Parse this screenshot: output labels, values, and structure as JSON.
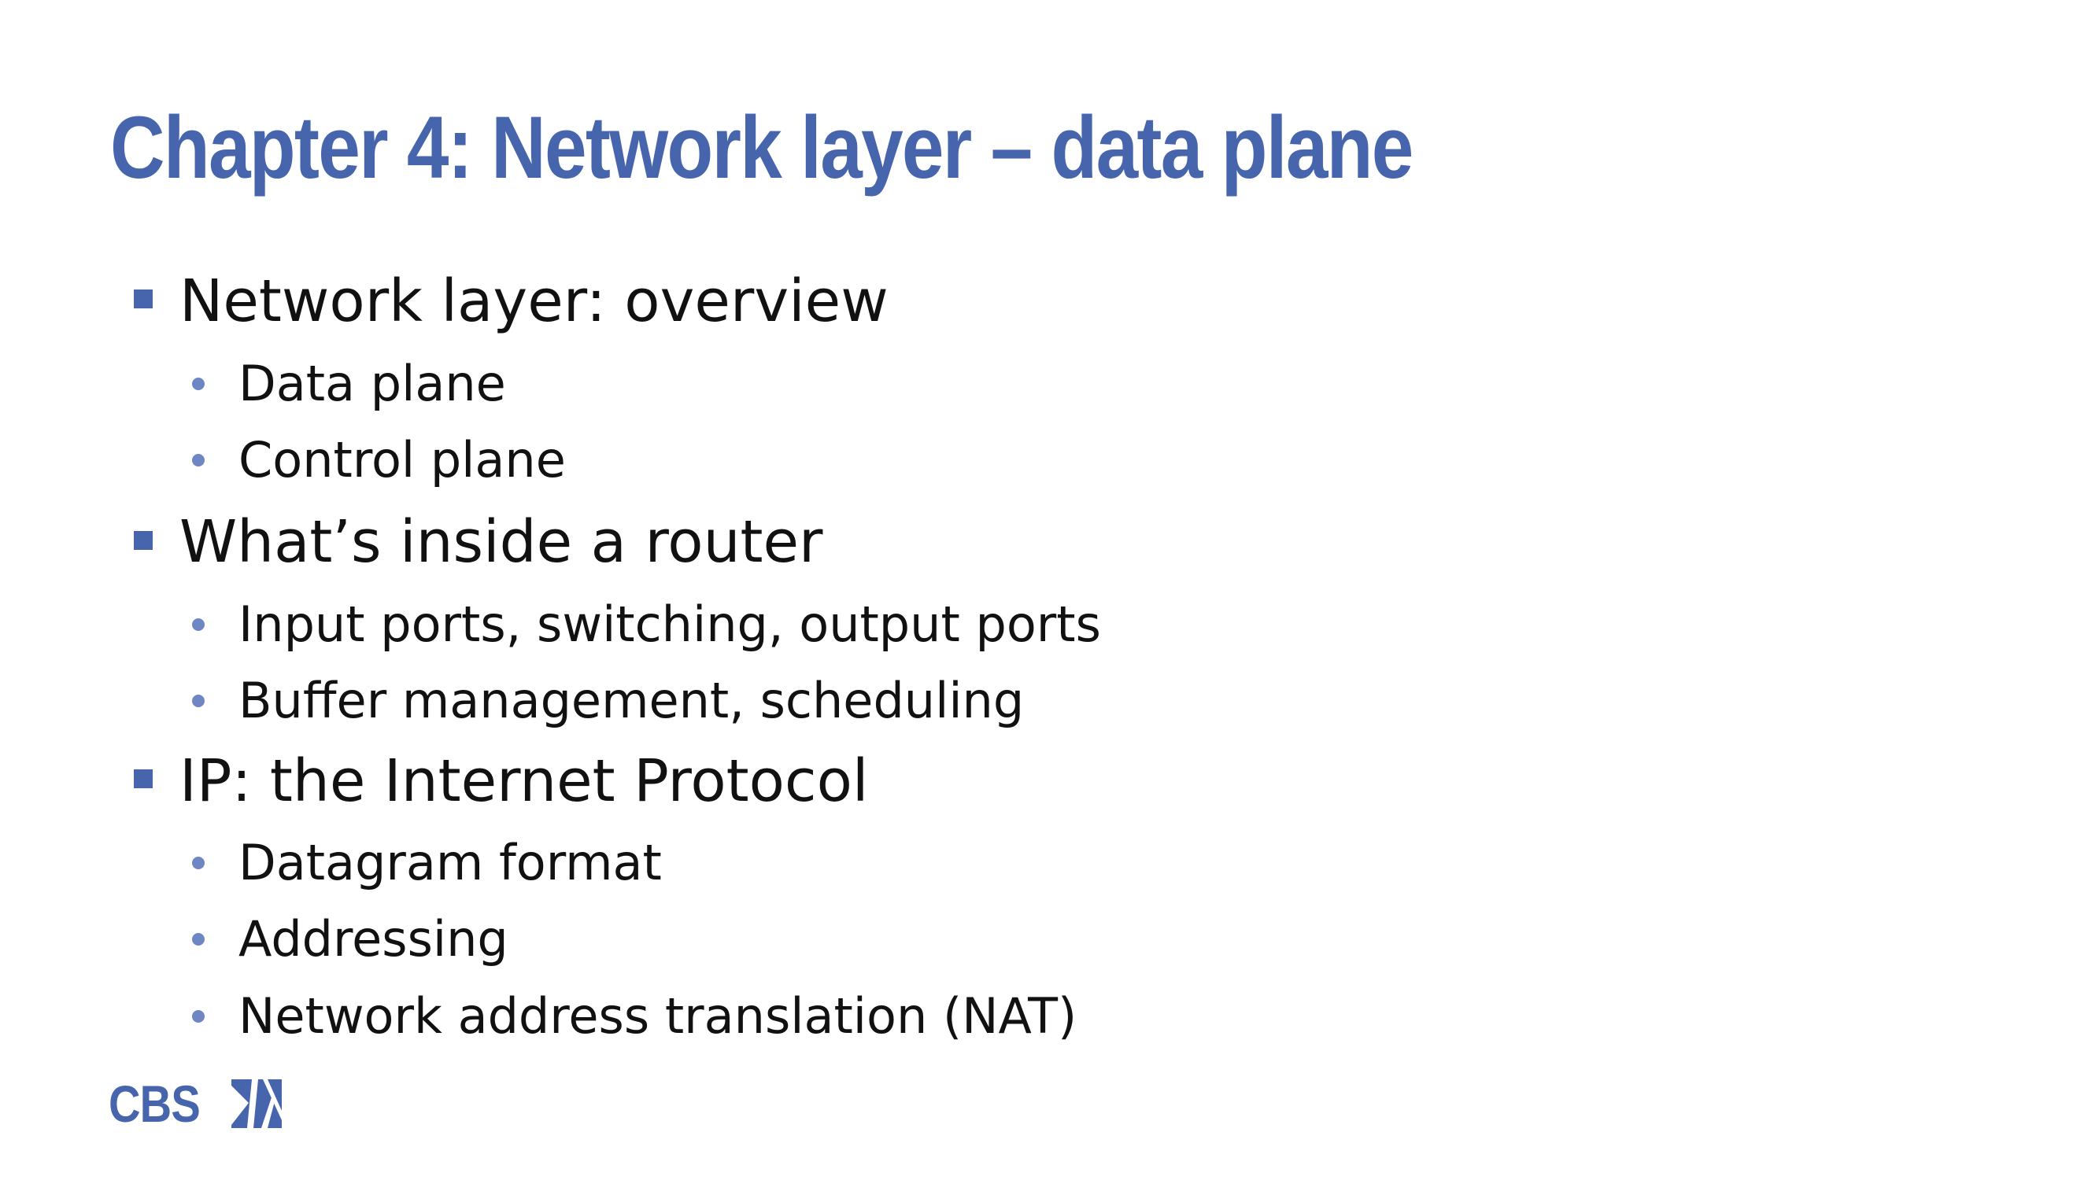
{
  "slide": {
    "title": "Chapter 4: Network layer – data plane",
    "bullets": [
      {
        "text": "Network layer: overview",
        "sub": [
          "Data plane",
          "Control plane"
        ]
      },
      {
        "text": "What’s inside a router",
        "sub": [
          "Input ports, switching, output ports",
          "Buffer management, scheduling"
        ]
      },
      {
        "text": "IP: the Internet Protocol",
        "sub": [
          "Datagram format",
          "Addressing",
          "Network address translation (NAT)"
        ]
      }
    ],
    "logo_text": "CBS",
    "colors": {
      "accent": "#4765AC",
      "text": "#111111",
      "background": "#FFFFFF"
    }
  }
}
